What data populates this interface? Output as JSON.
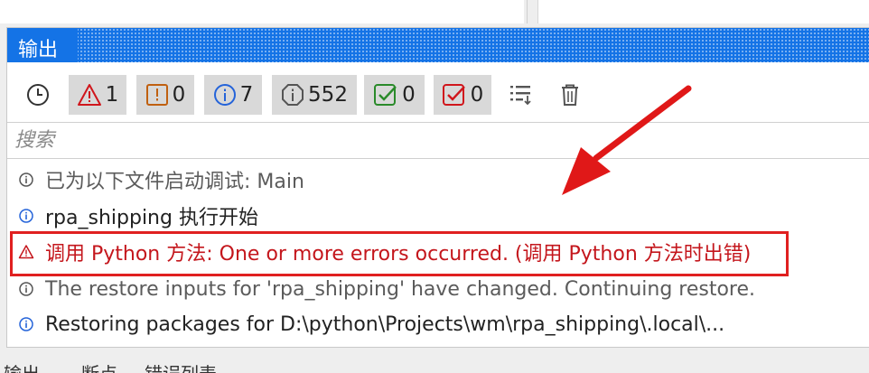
{
  "panel": {
    "title": "输出"
  },
  "toolbar": {
    "error_count": "1",
    "warning_count": "0",
    "info_count": "7",
    "trace_count": "552",
    "success_count": "0",
    "failure_count": "0"
  },
  "search": {
    "placeholder": "搜索"
  },
  "log": {
    "rows": [
      "已为以下文件启动调试: Main",
      "rpa_shipping 执行开始",
      "调用 Python 方法: One or more errors occurred. (调用 Python 方法时出错)",
      "The restore inputs for 'rpa_shipping' have changed. Continuing restore.",
      "Restoring packages for D:\\python\\Projects\\wm\\rpa_shipping\\.local\\..."
    ]
  },
  "bottom_tabs": {
    "output": "输出",
    "breakpoints": "断点",
    "error_list": "错误列表"
  },
  "colors": {
    "accent": "#1473e6",
    "error": "#c4161c",
    "annotation": "#e02020"
  }
}
